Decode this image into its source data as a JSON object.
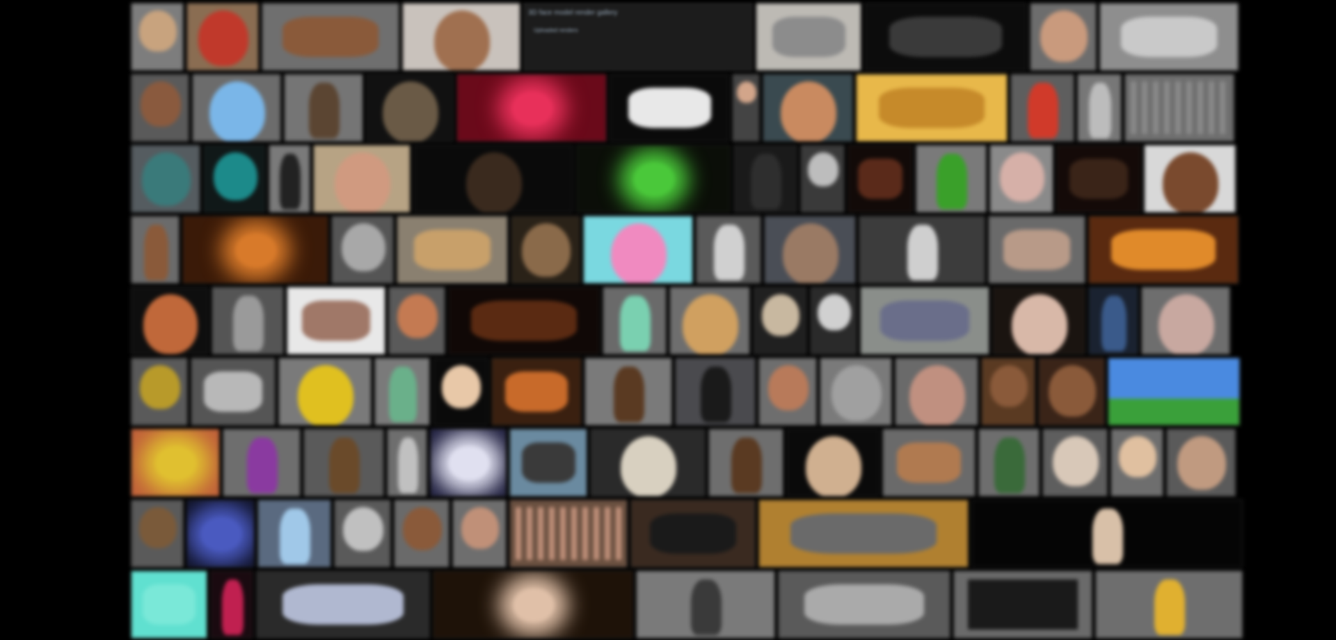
{
  "gallery": {
    "featured_title": "3D face model render gallery",
    "featured_subtitle": "Uploaded renders",
    "rows": [
      [
        {
          "w": 76,
          "bg": "#7d7d7d",
          "fg": "#c8a37e",
          "shape": "head"
        },
        {
          "w": 104,
          "bg": "#8a6d52",
          "fg": "#c0392b",
          "shape": "head"
        },
        {
          "w": 198,
          "bg": "#6f6f6f",
          "fg": "#8a5a3a",
          "shape": "blob"
        },
        {
          "w": 170,
          "bg": "#c9c2bc",
          "fg": "#a07050",
          "shape": "head"
        },
        {
          "w": 330,
          "bg": "#1c1c1c",
          "fg": "#3a5a80",
          "shape": "info"
        },
        {
          "w": 152,
          "bg": "#bdbab4",
          "fg": "#8c8c8c",
          "shape": "blob"
        },
        {
          "w": 234,
          "bg": "#0c0c0c",
          "fg": "#3a3a3a",
          "shape": "blob"
        },
        {
          "w": 96,
          "bg": "#6d6d6d",
          "fg": "#c99a7d",
          "shape": "head"
        },
        {
          "w": 200,
          "bg": "#8e8e8e",
          "fg": "#c9c9c9",
          "shape": "blob"
        }
      ],
      [
        {
          "w": 84,
          "bg": "#5a5a5a",
          "fg": "#8a5a3e",
          "shape": "head"
        },
        {
          "w": 128,
          "bg": "#6c6c6c",
          "fg": "#7ab6e8",
          "shape": "head"
        },
        {
          "w": 114,
          "bg": "#757575",
          "fg": "#5b4532",
          "shape": "figure"
        },
        {
          "w": 126,
          "bg": "#111111",
          "fg": "#6a5a46",
          "shape": "head"
        },
        {
          "w": 216,
          "bg": "#6a0a1a",
          "fg": "#e8305a",
          "shape": "glow"
        },
        {
          "w": 172,
          "bg": "#0a0a0a",
          "fg": "#e8e8e8",
          "shape": "blob"
        },
        {
          "w": 40,
          "bg": "#444444",
          "fg": "#d2a58a",
          "shape": "head"
        },
        {
          "w": 130,
          "bg": "#3a4a50",
          "fg": "#c98a60",
          "shape": "head"
        },
        {
          "w": 218,
          "bg": "#e8b84a",
          "fg": "#c68a2a",
          "shape": "blob"
        },
        {
          "w": 92,
          "bg": "#5e5e5e",
          "fg": "#d03a2a",
          "shape": "figure"
        },
        {
          "w": 64,
          "bg": "#777777",
          "fg": "#bcbcbc",
          "shape": "figure"
        },
        {
          "w": 158,
          "bg": "#6e6e6e",
          "fg": "#8a8a8a",
          "shape": "grid"
        }
      ],
      [
        {
          "w": 100,
          "bg": "#555c60",
          "fg": "#3a7a7a",
          "shape": "head"
        },
        {
          "w": 90,
          "bg": "#101818",
          "fg": "#1c8a8a",
          "shape": "head"
        },
        {
          "w": 60,
          "bg": "#7a7a7a",
          "fg": "#222222",
          "shape": "figure"
        },
        {
          "w": 140,
          "bg": "#b7a384",
          "fg": "#d09a80",
          "shape": "head"
        },
        {
          "w": 230,
          "bg": "#0a0a0a",
          "fg": "#3a2a1e",
          "shape": "head"
        },
        {
          "w": 222,
          "bg": "#0b0e08",
          "fg": "#4ac83a",
          "shape": "glow"
        },
        {
          "w": 92,
          "bg": "#1a1a1a",
          "fg": "#2e2e2e",
          "shape": "figure"
        },
        {
          "w": 64,
          "bg": "#3a3a3a",
          "fg": "#bdbdbd",
          "shape": "head"
        },
        {
          "w": 94,
          "bg": "#120a08",
          "fg": "#5a2a1a",
          "shape": "blob"
        },
        {
          "w": 102,
          "bg": "#7a7a7a",
          "fg": "#3aa02a",
          "shape": "figure"
        },
        {
          "w": 92,
          "bg": "#8a8a8a",
          "fg": "#d6b0a8",
          "shape": "head"
        },
        {
          "w": 122,
          "bg": "#140a08",
          "fg": "#3a2418",
          "shape": "blob"
        },
        {
          "w": 132,
          "bg": "#d8d8d8",
          "fg": "#7a4a2e",
          "shape": "head"
        }
      ],
      [
        {
          "w": 70,
          "bg": "#6b6b6b",
          "fg": "#8a5a3a",
          "shape": "figure"
        },
        {
          "w": 210,
          "bg": "#3a1a08",
          "fg": "#d87a2a",
          "shape": "glow"
        },
        {
          "w": 90,
          "bg": "#555555",
          "fg": "#a8a8a8",
          "shape": "head"
        },
        {
          "w": 160,
          "bg": "#8a8070",
          "fg": "#c8a06a",
          "shape": "blob"
        },
        {
          "w": 100,
          "bg": "#2a2218",
          "fg": "#8a6a4a",
          "shape": "head"
        },
        {
          "w": 158,
          "bg": "#7ad8e0",
          "fg": "#f08ac0",
          "shape": "head"
        },
        {
          "w": 94,
          "bg": "#5a5a5a",
          "fg": "#d0d0d0",
          "shape": "figure"
        },
        {
          "w": 132,
          "bg": "#4a4e56",
          "fg": "#9a7a64",
          "shape": "head"
        },
        {
          "w": 182,
          "bg": "#3c3c3c",
          "fg": "#cfcfcf",
          "shape": "figure"
        },
        {
          "w": 140,
          "bg": "#6a6a6a",
          "fg": "#b89a88",
          "shape": "blob"
        },
        {
          "w": 216,
          "bg": "#5a2a10",
          "fg": "#e08a2a",
          "shape": "blob"
        }
      ],
      [
        {
          "w": 112,
          "bg": "#0e0e0e",
          "fg": "#c0683a",
          "shape": "head"
        },
        {
          "w": 104,
          "bg": "#555555",
          "fg": "#9a9a9a",
          "shape": "figure"
        },
        {
          "w": 142,
          "bg": "#e8e8e8",
          "fg": "#a07868",
          "shape": "blob"
        },
        {
          "w": 82,
          "bg": "#5a5a5a",
          "fg": "#c47a52",
          "shape": "head"
        },
        {
          "w": 218,
          "bg": "#100806",
          "fg": "#5a2a12",
          "shape": "blob"
        },
        {
          "w": 92,
          "bg": "#6a6a6a",
          "fg": "#7ad0b0",
          "shape": "figure"
        },
        {
          "w": 116,
          "bg": "#6e6e6e",
          "fg": "#d0a060",
          "shape": "head"
        },
        {
          "w": 78,
          "bg": "#202020",
          "fg": "#c8b8a0",
          "shape": "head"
        },
        {
          "w": 68,
          "bg": "#2a2a2a",
          "fg": "#d0d0d0",
          "shape": "head"
        },
        {
          "w": 186,
          "bg": "#8a8e8a",
          "fg": "#6a6e8a",
          "shape": "blob"
        },
        {
          "w": 134,
          "bg": "#1a1410",
          "fg": "#d8b8a8",
          "shape": "head"
        },
        {
          "w": 72,
          "bg": "#1a2230",
          "fg": "#3a5a8a",
          "shape": "figure"
        },
        {
          "w": 128,
          "bg": "#6e6e6e",
          "fg": "#c8a8a0",
          "shape": "head"
        }
      ],
      [
        {
          "w": 82,
          "bg": "#5a5a5a",
          "fg": "#b89a2a",
          "shape": "head"
        },
        {
          "w": 122,
          "bg": "#555555",
          "fg": "#b8b8b8",
          "shape": "blob"
        },
        {
          "w": 134,
          "bg": "#7a7a7a",
          "fg": "#e0c020",
          "shape": "head"
        },
        {
          "w": 80,
          "bg": "#7a7a7a",
          "fg": "#6ab08a",
          "shape": "figure"
        },
        {
          "w": 80,
          "bg": "#0a0a0a",
          "fg": "#e8c8a8",
          "shape": "head"
        },
        {
          "w": 130,
          "bg": "#3a2010",
          "fg": "#c86a2a",
          "shape": "blob"
        },
        {
          "w": 126,
          "bg": "#7a7a7a",
          "fg": "#5a3a22",
          "shape": "figure"
        },
        {
          "w": 116,
          "bg": "#4a4a4e",
          "fg": "#1a1a1a",
          "shape": "figure"
        },
        {
          "w": 84,
          "bg": "#6e6e6e",
          "fg": "#b87a5a",
          "shape": "head"
        },
        {
          "w": 104,
          "bg": "#7a7a7a",
          "fg": "#a0a0a0",
          "shape": "head"
        },
        {
          "w": 120,
          "bg": "#6a6a6a",
          "fg": "#c09080",
          "shape": "head"
        },
        {
          "w": 78,
          "bg": "#5a3a22",
          "fg": "#8a5a3a",
          "shape": "head"
        },
        {
          "w": 96,
          "bg": "#3a2418",
          "fg": "#8a5a3a",
          "shape": "head"
        },
        {
          "w": 190,
          "bg": "#4a8ae0",
          "fg": "#3aa03a",
          "shape": "land"
        }
      ],
      [
        {
          "w": 128,
          "bg": "#c0603a",
          "fg": "#e0c030",
          "shape": "glow"
        },
        {
          "w": 112,
          "bg": "#6e6e6e",
          "fg": "#8a3aa0",
          "shape": "figure"
        },
        {
          "w": 116,
          "bg": "#5a5a5a",
          "fg": "#6a4a2a",
          "shape": "figure"
        },
        {
          "w": 58,
          "bg": "#6e6e6e",
          "fg": "#c0c0c0",
          "shape": "figure"
        },
        {
          "w": 110,
          "bg": "#1a1a3a",
          "fg": "#e0e0f0",
          "shape": "glow"
        },
        {
          "w": 112,
          "bg": "#6a8aa0",
          "fg": "#3a3a3a",
          "shape": "blob"
        },
        {
          "w": 166,
          "bg": "#2a2a2a",
          "fg": "#d8d0c0",
          "shape": "head"
        },
        {
          "w": 108,
          "bg": "#6e6e6e",
          "fg": "#5a3a22",
          "shape": "figure"
        },
        {
          "w": 134,
          "bg": "#0a0a0a",
          "fg": "#d0b090",
          "shape": "head"
        },
        {
          "w": 134,
          "bg": "#6a6a6a",
          "fg": "#b07a50",
          "shape": "blob"
        },
        {
          "w": 88,
          "bg": "#6e6e6e",
          "fg": "#3a6a3a",
          "shape": "figure"
        },
        {
          "w": 94,
          "bg": "#5e5e5e",
          "fg": "#d8c8b8",
          "shape": "head"
        },
        {
          "w": 76,
          "bg": "#6e6e6e",
          "fg": "#e0c0a0",
          "shape": "head"
        },
        {
          "w": 100,
          "bg": "#5a5a5a",
          "fg": "#c09a80",
          "shape": "head"
        }
      ],
      [
        {
          "w": 76,
          "bg": "#5a5a5a",
          "fg": "#7a5a3a",
          "shape": "head"
        },
        {
          "w": 98,
          "bg": "#0e1022",
          "fg": "#4a5ac0",
          "shape": "glow"
        },
        {
          "w": 106,
          "bg": "#5a6a80",
          "fg": "#a0c8e8",
          "shape": "figure"
        },
        {
          "w": 82,
          "bg": "#5a5a5a",
          "fg": "#c0c0c0",
          "shape": "head"
        },
        {
          "w": 80,
          "bg": "#6a6a6a",
          "fg": "#8a5a3a",
          "shape": "head"
        },
        {
          "w": 78,
          "bg": "#6e6e6e",
          "fg": "#c09078",
          "shape": "head"
        },
        {
          "w": 170,
          "bg": "#6a5040",
          "fg": "#c0907a",
          "shape": "grid"
        },
        {
          "w": 180,
          "bg": "#3a2a20",
          "fg": "#1a1a1a",
          "shape": "blob"
        },
        {
          "w": 302,
          "bg": "#b08030",
          "fg": "#6a6a6a",
          "shape": "blob"
        },
        {
          "w": 390,
          "bg": "#050505",
          "fg": "#d8c0a8",
          "shape": "figure"
        }
      ],
      [
        {
          "w": 110,
          "bg": "#60e0d0",
          "fg": "#7ae8d8",
          "shape": "blob"
        },
        {
          "w": 62,
          "bg": "#1a0a10",
          "fg": "#c02050",
          "shape": "figure"
        },
        {
          "w": 250,
          "bg": "#2a2a2a",
          "fg": "#b0b8d0",
          "shape": "blob"
        },
        {
          "w": 288,
          "bg": "#1e1208",
          "fg": "#e0c0a8",
          "shape": "glow"
        },
        {
          "w": 200,
          "bg": "#7a7a7a",
          "fg": "#3a3a3a",
          "shape": "figure"
        },
        {
          "w": 248,
          "bg": "#5a5a5a",
          "fg": "#aaaaaa",
          "shape": "blob"
        },
        {
          "w": 200,
          "bg": "#6a6a6a",
          "fg": "#1a1a1a",
          "shape": "screen"
        },
        {
          "w": 212,
          "bg": "#6e6e6e",
          "fg": "#e0b030",
          "shape": "figure"
        }
      ]
    ]
  }
}
